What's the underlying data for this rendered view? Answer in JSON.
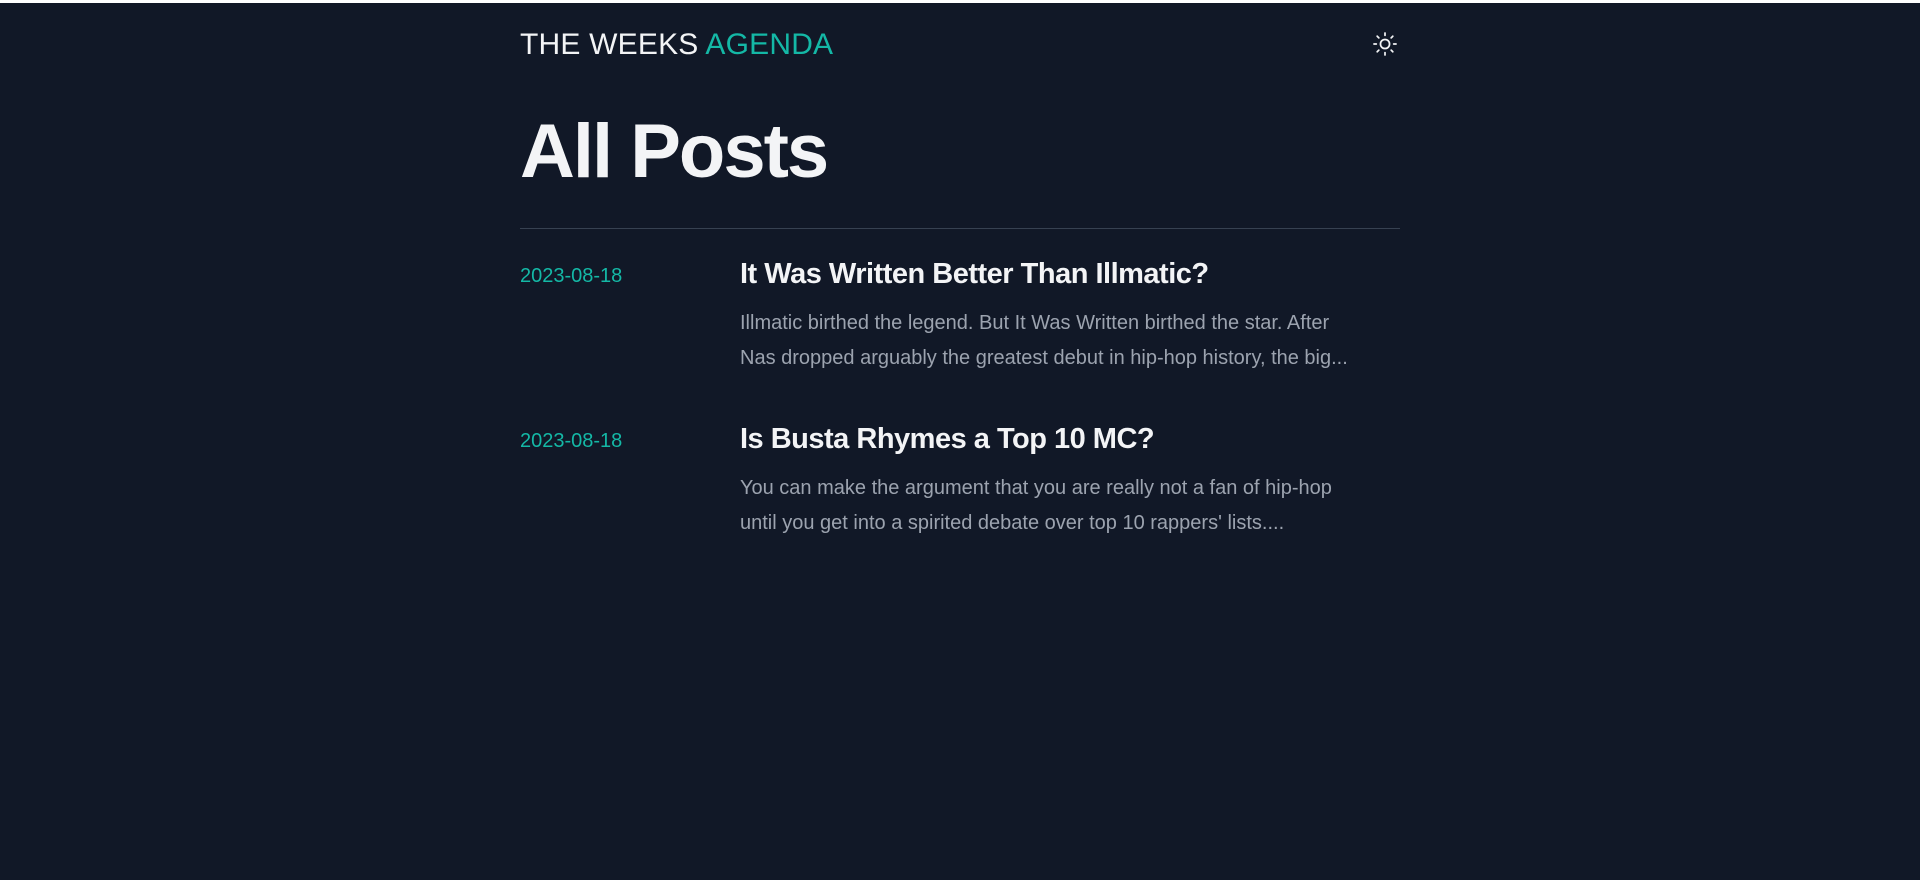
{
  "header": {
    "logo_main": "THE WEEKS ",
    "logo_accent": "AGENDA",
    "theme_toggle_icon": "sun-icon"
  },
  "page": {
    "title": "All Posts"
  },
  "posts": [
    {
      "date": "2023-08-18",
      "title": "It Was Written Better Than Illmatic?",
      "excerpt_lines": [
        "Illmatic birthed the legend. But It Was Written birthed the star. After",
        "Nas dropped arguably the greatest debut in hip-hop history, the big..."
      ]
    },
    {
      "date": "2023-08-18",
      "title": "Is Busta Rhymes a Top 10 MC?",
      "excerpt_lines": [
        "You can make the argument that you are really not a fan of hip-hop",
        "until you get into a spirited debate over top 10 rappers' lists...."
      ]
    }
  ],
  "colors": {
    "background": "#111827",
    "accent": "#14b8a6",
    "text": "#f3f4f6",
    "muted": "#9ca3af",
    "divider": "#374151"
  }
}
